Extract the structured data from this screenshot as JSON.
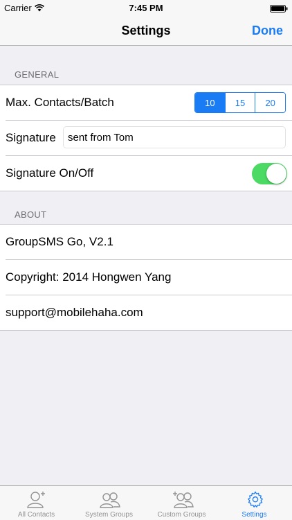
{
  "status_bar": {
    "carrier": "Carrier",
    "time": "7:45 PM"
  },
  "nav": {
    "title": "Settings",
    "done_label": "Done"
  },
  "general": {
    "header": "GENERAL",
    "max_contacts": {
      "label": "Max. Contacts/Batch",
      "options": [
        "10",
        "15",
        "20"
      ],
      "selected": "10"
    },
    "signature": {
      "label": "Signature",
      "value": "sent from Tom"
    },
    "signature_toggle": {
      "label": "Signature On/Off",
      "on": true
    }
  },
  "about": {
    "header": "ABOUT",
    "items": [
      "GroupSMS Go,  V2.1",
      "Copyright: 2014 Hongwen Yang",
      "support@mobilehaha.com"
    ]
  },
  "tab_bar": {
    "tabs": [
      {
        "label": "All Contacts",
        "icon": "add-contact-icon"
      },
      {
        "label": "System Groups",
        "icon": "group-icon"
      },
      {
        "label": "Custom Groups",
        "icon": "add-group-icon"
      },
      {
        "label": "Settings",
        "icon": "gear-icon"
      }
    ],
    "active": "Settings"
  },
  "colors": {
    "accent": "#1a7cf5",
    "toggle_on": "#4cd964",
    "background": "#efeff4",
    "section_header": "#6d6d72",
    "tab_inactive": "#929292"
  }
}
